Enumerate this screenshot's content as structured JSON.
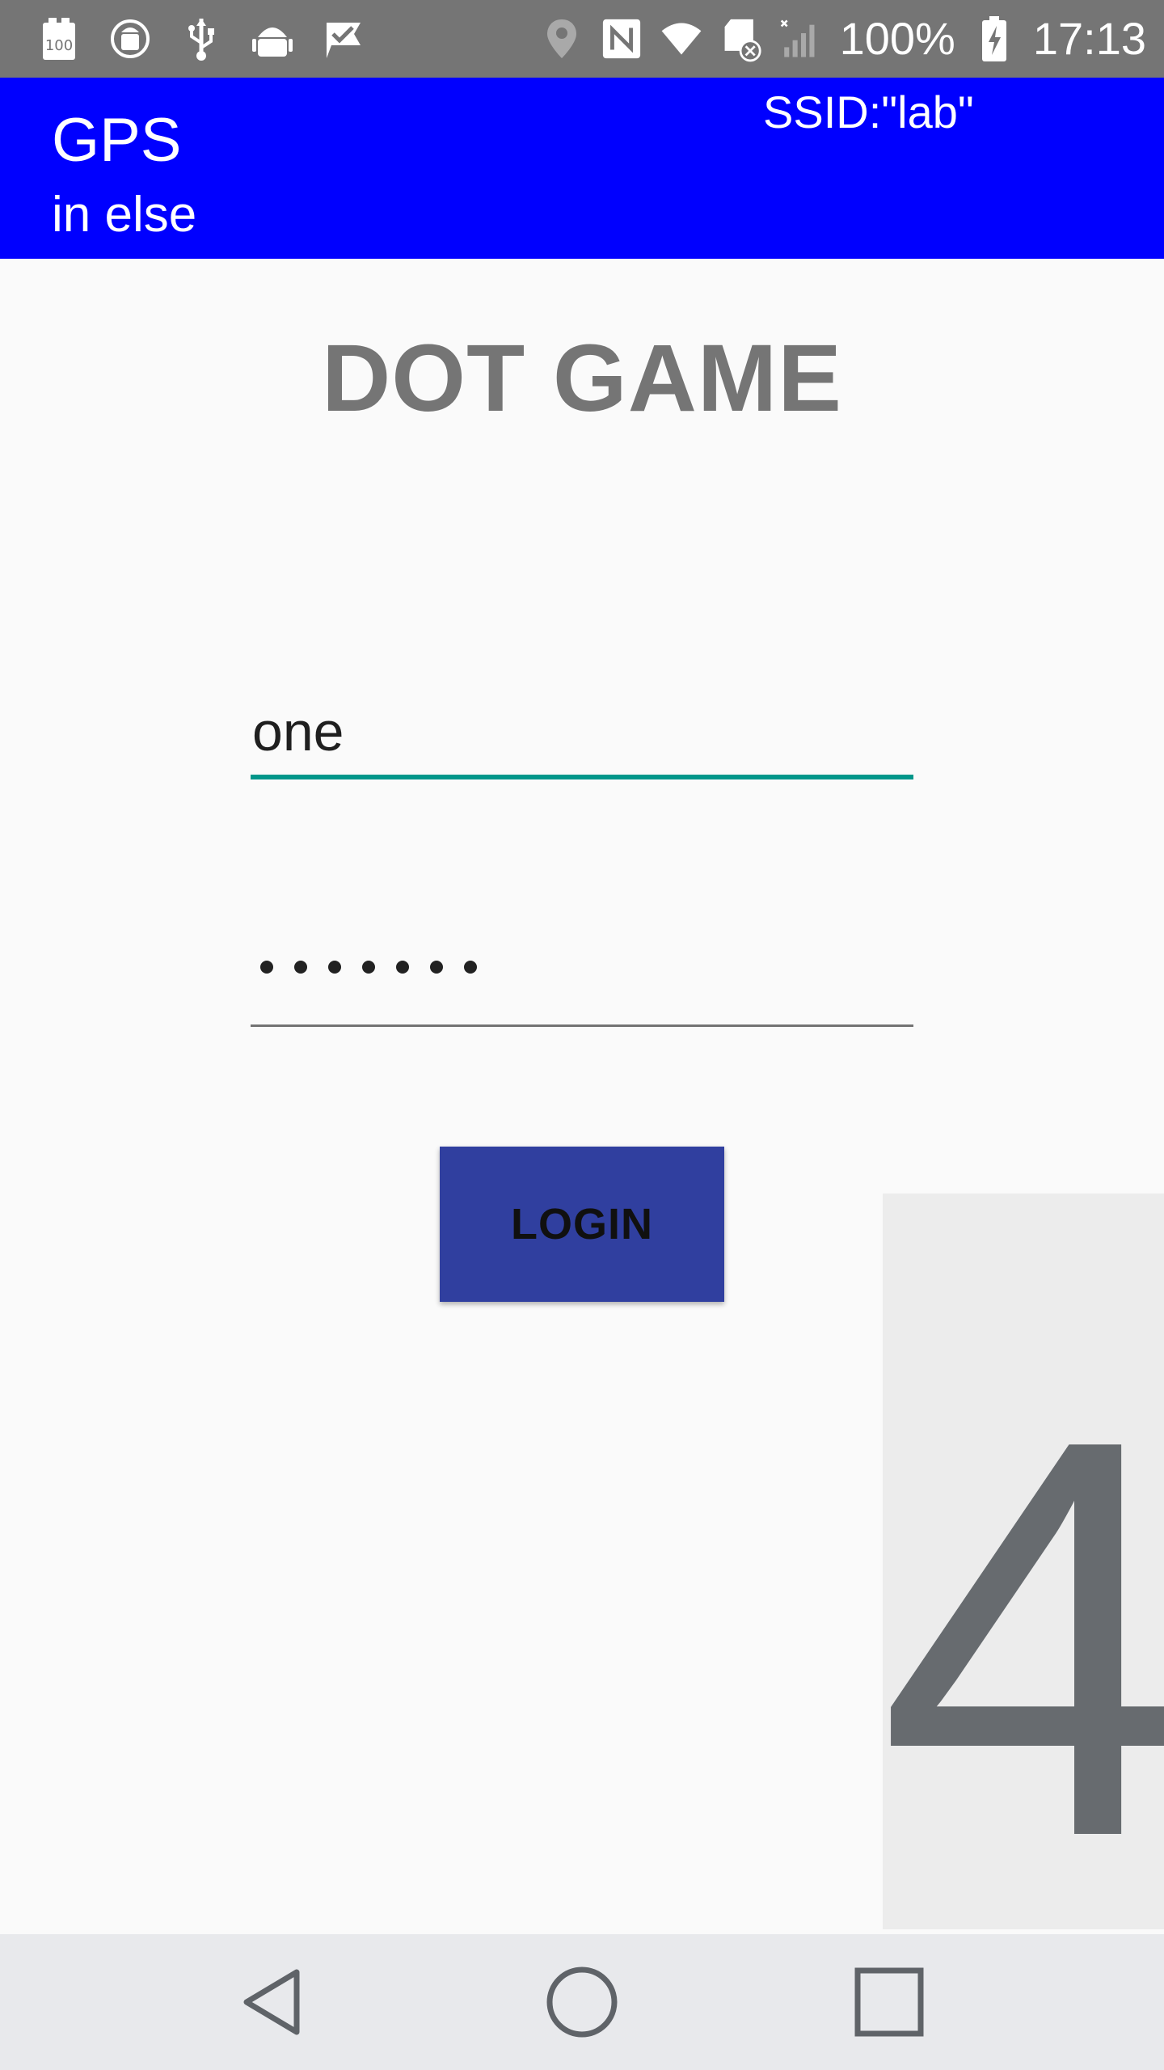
{
  "status_bar": {
    "battery_percent": "100%",
    "time": "17:13",
    "left_icons": [
      "storage-100-icon",
      "android-sync-icon",
      "usb-icon",
      "android-debug-icon",
      "checkmark-flag-icon"
    ],
    "right_icons": [
      "location-icon",
      "nfc-icon",
      "wifi-icon",
      "sd-card-error-icon",
      "signal-icon",
      "battery-charging-icon"
    ]
  },
  "app_bar": {
    "title": "GPS",
    "subtitle": "in else",
    "ssid": "SSID:\"lab\"",
    "background_color": "#0000ff"
  },
  "main": {
    "game_title": "DOT GAME",
    "username_value": "one",
    "password_length": 7,
    "login_label": "LOGIN",
    "counter_digit": "4"
  },
  "nav_bar": {
    "buttons": [
      "back-icon",
      "home-icon",
      "recents-icon"
    ]
  },
  "colors": {
    "accent": "#00968a",
    "button": "#303f9f",
    "status_bar": "#757575"
  }
}
